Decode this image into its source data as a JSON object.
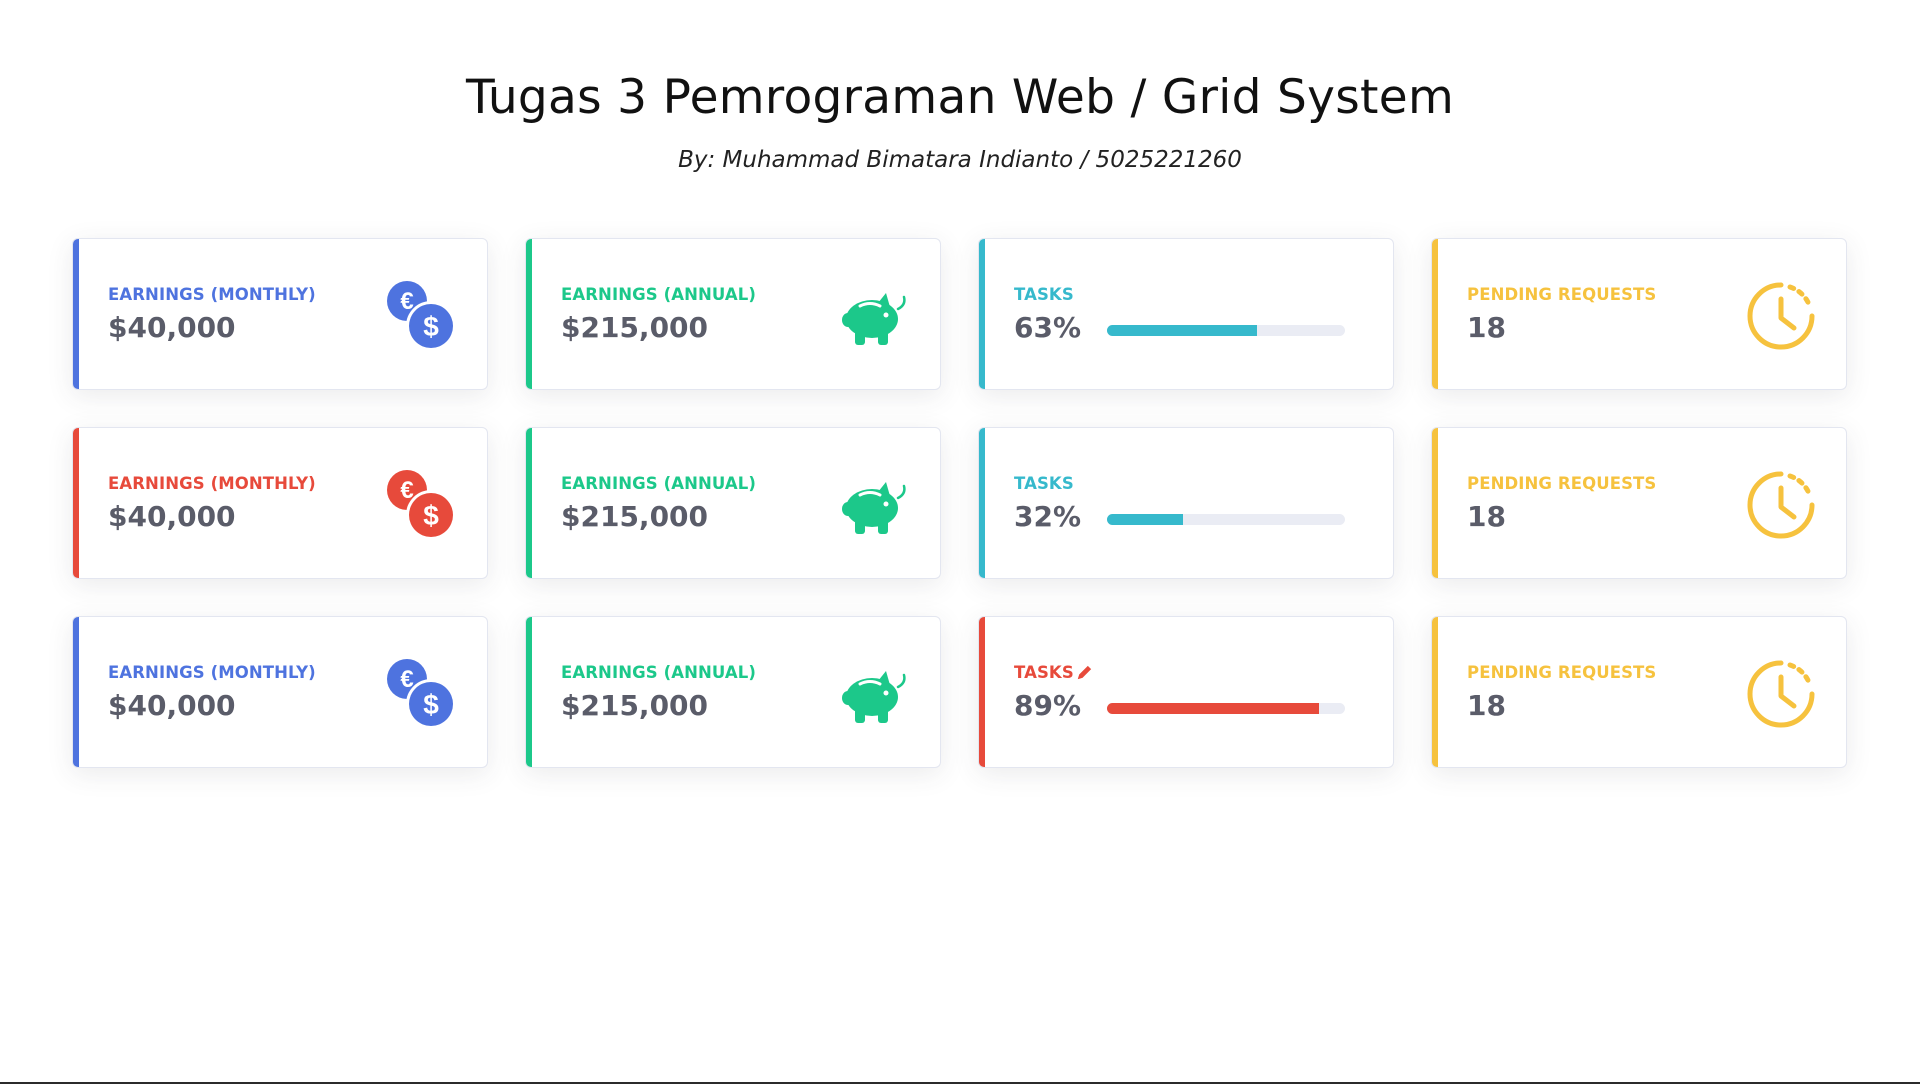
{
  "header": {
    "title": "Tugas 3 Pemrograman Web / Grid System",
    "subtitle": "By: Muhammad Bimatara Indianto / 5025221260"
  },
  "colors": {
    "primary": "#4e73df",
    "success": "#1cc88a",
    "info": "#36b9cc",
    "warning": "#f6c23e",
    "danger": "#e74a3b"
  },
  "cards": [
    {
      "type": "earnings-monthly",
      "color": "primary",
      "label": "Earnings (Monthly)",
      "value": "$40,000",
      "icon": "euro-dollar-coins-icon"
    },
    {
      "type": "earnings-annual",
      "color": "success",
      "label": "Earnings (Annual)",
      "value": "$215,000",
      "icon": "piggy-bank-icon"
    },
    {
      "type": "tasks",
      "color": "info",
      "label": "Tasks",
      "value": "63%",
      "progress": 63
    },
    {
      "type": "pending",
      "color": "warning",
      "label": "Pending Requests",
      "value": "18",
      "icon": "clock-icon"
    },
    {
      "type": "earnings-monthly",
      "color": "danger",
      "label": "Earnings (Monthly)",
      "value": "$40,000",
      "icon": "euro-dollar-coins-icon"
    },
    {
      "type": "earnings-annual",
      "color": "success",
      "label": "Earnings (Annual)",
      "value": "$215,000",
      "icon": "piggy-bank-icon"
    },
    {
      "type": "tasks",
      "color": "info",
      "label": "Tasks",
      "value": "32%",
      "progress": 32
    },
    {
      "type": "pending",
      "color": "warning",
      "label": "Pending Requests",
      "value": "18",
      "icon": "clock-icon"
    },
    {
      "type": "earnings-monthly",
      "color": "primary",
      "label": "Earnings (Monthly)",
      "value": "$40,000",
      "icon": "euro-dollar-coins-icon"
    },
    {
      "type": "earnings-annual",
      "color": "success",
      "label": "Earnings (Annual)",
      "value": "$215,000",
      "icon": "piggy-bank-icon"
    },
    {
      "type": "tasks",
      "color": "danger",
      "label": "Tasks",
      "value": "89%",
      "progress": 89,
      "label_icon": "pencil-icon"
    },
    {
      "type": "pending",
      "color": "warning",
      "label": "Pending Requests",
      "value": "18",
      "icon": "clock-icon"
    }
  ]
}
